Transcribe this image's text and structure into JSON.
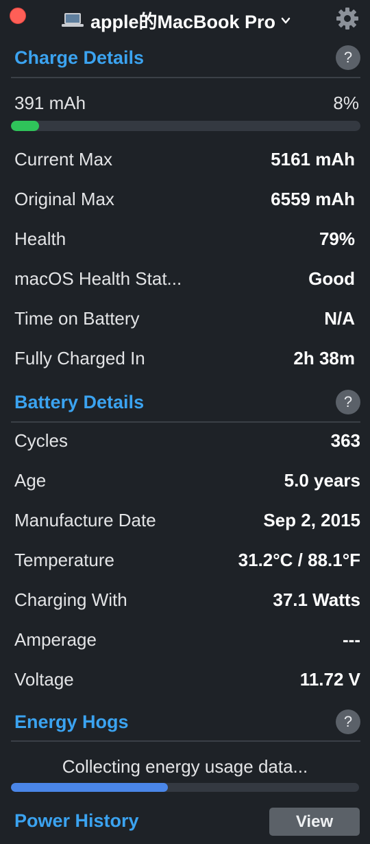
{
  "window": {
    "device_name": "apple的MacBook Pro",
    "icons": {
      "close": "close-icon",
      "device": "laptop-icon",
      "dropdown": "chevron-down-icon",
      "settings": "gear-icon"
    }
  },
  "charge_details": {
    "title": "Charge Details",
    "help": "?",
    "current_charge": "391 mAh",
    "percent_text": "8%",
    "charge_fraction": 0.08,
    "rows": [
      {
        "label": "Current Max",
        "value": "5161 mAh"
      },
      {
        "label": "Original Max",
        "value": "6559 mAh"
      },
      {
        "label": "Health",
        "value": "79%"
      },
      {
        "label": "macOS Health Stat...",
        "value": "Good"
      },
      {
        "label": "Time on Battery",
        "value": "N/A"
      },
      {
        "label": "Fully Charged In",
        "value": "2h 38m"
      }
    ]
  },
  "battery_details": {
    "title": "Battery Details",
    "help": "?",
    "rows": [
      {
        "label": "Cycles",
        "value": "363"
      },
      {
        "label": "Age",
        "value": "5.0 years"
      },
      {
        "label": "Manufacture Date",
        "value": "Sep 2, 2015"
      },
      {
        "label": "Temperature",
        "value": "31.2°C / 88.1°F"
      },
      {
        "label": "Charging With",
        "value": "37.1 Watts"
      },
      {
        "label": "Amperage",
        "value": "---"
      },
      {
        "label": "Voltage",
        "value": "11.72 V"
      }
    ]
  },
  "energy_hogs": {
    "title": "Energy Hogs",
    "help": "?",
    "status": "Collecting energy usage data...",
    "progress_fraction": 0.45
  },
  "power_history": {
    "title": "Power History",
    "button_label": "View"
  },
  "colors": {
    "background": "#1e2227",
    "accent_blue": "#3ba3f0",
    "charge_green": "#2fc35a",
    "progress_blue": "#4a86e8",
    "close_red": "#fe5f57"
  }
}
